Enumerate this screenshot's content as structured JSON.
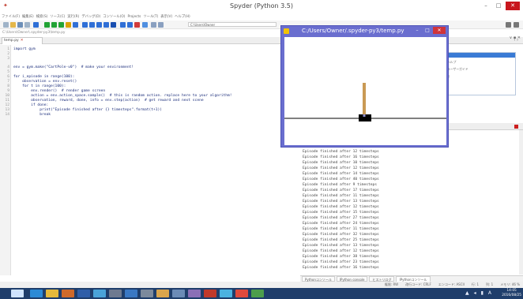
{
  "window": {
    "title": "Spyder (Python 3.5)",
    "controls": [
      "–",
      "□",
      "✕"
    ]
  },
  "menu": [
    "ファイル(F)",
    "編集(E)",
    "検索(S)",
    "ソース(C)",
    "実行(R)",
    "デバッグ(D)",
    "コンソール(O)",
    "Projects",
    "ツール(T)",
    "表示(V)",
    "ヘルプ(H)"
  ],
  "toolbar": {
    "path_field": "C:\\Users\\Owner"
  },
  "pathbar": "C:\\Users\\Owner\\.spyder-py3\\temp.py",
  "editor": {
    "tab_label": "temp.py",
    "lines": [
      {
        "n": "1",
        "text": "import gym"
      },
      {
        "n": "2",
        "text": ""
      },
      {
        "n": "3",
        "text": ""
      },
      {
        "n": "4",
        "text": "env = gym.make(\"CartPole-v0\")  # make your environment!"
      },
      {
        "n": "5",
        "text": ""
      },
      {
        "n": "6",
        "text": "for i_episode in range(100):"
      },
      {
        "n": "7",
        "text": "    observation = env.reset()"
      },
      {
        "n": "8",
        "text": "    for t in range(100):"
      },
      {
        "n": "9",
        "text": "        env.render()  # render game screen"
      },
      {
        "n": "10",
        "text": "        action = env.action_space.sample()  # this is random action. replace here to your algorithm!"
      },
      {
        "n": "11",
        "text": "        observation, reward, done, info = env.step(action)  # get reward and next scene"
      },
      {
        "n": "12",
        "text": "        if done:"
      },
      {
        "n": "13",
        "text": "            print(\"Episode finished after {} timesteps\".format(t+1))"
      },
      {
        "n": "14",
        "text": "            break"
      }
    ]
  },
  "help_panel": {
    "rows": [
      "ヘルプ",
      "ユーザーガイド",
      "を"
    ]
  },
  "console": {
    "lines": [
      "Episode finished after 17 timesteps",
      "Episode finished after 12 timesteps",
      "Episode finished after 16 timesteps",
      "Episode finished after 10 timesteps",
      "Episode finished after 12 timesteps",
      "Episode finished after 14 timesteps",
      "Episode finished after 40 timesteps",
      "Episode finished after 9 timesteps",
      "Episode finished after 17 timesteps",
      "Episode finished after 11 timesteps",
      "Episode finished after 13 timesteps",
      "Episode finished after 12 timesteps",
      "Episode finished after 15 timesteps",
      "Episode finished after 27 timesteps",
      "Episode finished after 24 timesteps",
      "Episode finished after 11 timesteps",
      "Episode finished after 32 timesteps",
      "Episode finished after 25 timesteps",
      "Episode finished after 13 timesteps",
      "Episode finished after 12 timesteps",
      "Episode finished after 38 timesteps",
      "Episode finished after 23 timesteps",
      "Episode finished after 16 timesteps"
    ]
  },
  "bottom_tabs": [
    "Pythonコンソール",
    "IPython console",
    "ヒストリログ",
    "IPythonコンソール"
  ],
  "status": {
    "permissions": "権限: RW",
    "eol": "改行コード: CRLF",
    "encoding": "エンコード: ASCII",
    "line": "行: 1",
    "column": "列: 1",
    "memory": "メモリ: 46 %"
  },
  "render_window": {
    "title": "C:/Users/Owner/.spyder-py3/temp.py",
    "controls": [
      "–",
      "□",
      "✕"
    ]
  },
  "taskbar": {
    "time": "14:05",
    "date": "2016/08/25"
  },
  "colors": {
    "render_window_frame": "#6a6ecf",
    "pole": "#c99a55",
    "cart": "#000000",
    "taskbar": "#1f3e6b",
    "close_button": "#c8161d"
  }
}
